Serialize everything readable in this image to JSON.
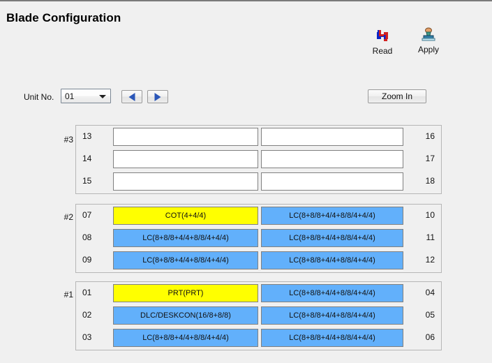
{
  "window": {
    "title": "Blade Configuration"
  },
  "toolbar": {
    "read": {
      "label": "Read",
      "icon": "refresh-icon"
    },
    "apply": {
      "label": "Apply",
      "icon": "stamp-icon"
    }
  },
  "controls": {
    "unit_label": "Unit No.",
    "unit_value": "01",
    "unit_options": [
      "01"
    ],
    "prev_label": "◀",
    "next_label": "▶",
    "zoom_in_label": "Zoom In"
  },
  "colors": {
    "blade_blue": "#62b0fb",
    "blade_yellow": "#ffff00",
    "blade_empty": "#ffffff",
    "window_background": "#f0f0f0",
    "arrow_blue": "#2a56b8"
  },
  "groups": [
    {
      "tag": "#3",
      "rows": [
        {
          "left_num": "13",
          "left_text": "",
          "left_state": "empty",
          "right_num": "16",
          "right_text": "",
          "right_state": "empty"
        },
        {
          "left_num": "14",
          "left_text": "",
          "left_state": "empty",
          "right_num": "17",
          "right_text": "",
          "right_state": "empty"
        },
        {
          "left_num": "15",
          "left_text": "",
          "left_state": "empty",
          "right_num": "18",
          "right_text": "",
          "right_state": "empty"
        }
      ]
    },
    {
      "tag": "#2",
      "rows": [
        {
          "left_num": "07",
          "left_text": "COT(4+4/4)",
          "left_state": "yellow",
          "right_num": "10",
          "right_text": "LC(8+8/8+4/4+8/8/4+4/4)",
          "right_state": "blue"
        },
        {
          "left_num": "08",
          "left_text": "LC(8+8/8+4/4+8/8/4+4/4)",
          "left_state": "blue",
          "right_num": "11",
          "right_text": "LC(8+8/8+4/4+8/8/4+4/4)",
          "right_state": "blue"
        },
        {
          "left_num": "09",
          "left_text": "LC(8+8/8+4/4+8/8/4+4/4)",
          "left_state": "blue",
          "right_num": "12",
          "right_text": "LC(8+8/8+4/4+8/8/4+4/4)",
          "right_state": "blue"
        }
      ]
    },
    {
      "tag": "#1",
      "rows": [
        {
          "left_num": "01",
          "left_text": "PRT(PRT)",
          "left_state": "yellow",
          "right_num": "04",
          "right_text": "LC(8+8/8+4/4+8/8/4+4/4)",
          "right_state": "blue"
        },
        {
          "left_num": "02",
          "left_text": "DLC/DESKCON(16/8+8/8)",
          "left_state": "blue",
          "right_num": "05",
          "right_text": "LC(8+8/8+4/4+8/8/4+4/4)",
          "right_state": "blue"
        },
        {
          "left_num": "03",
          "left_text": "LC(8+8/8+4/4+8/8/4+4/4)",
          "left_state": "blue",
          "right_num": "06",
          "right_text": "LC(8+8/8+4/4+8/8/4+4/4)",
          "right_state": "blue"
        }
      ]
    }
  ]
}
